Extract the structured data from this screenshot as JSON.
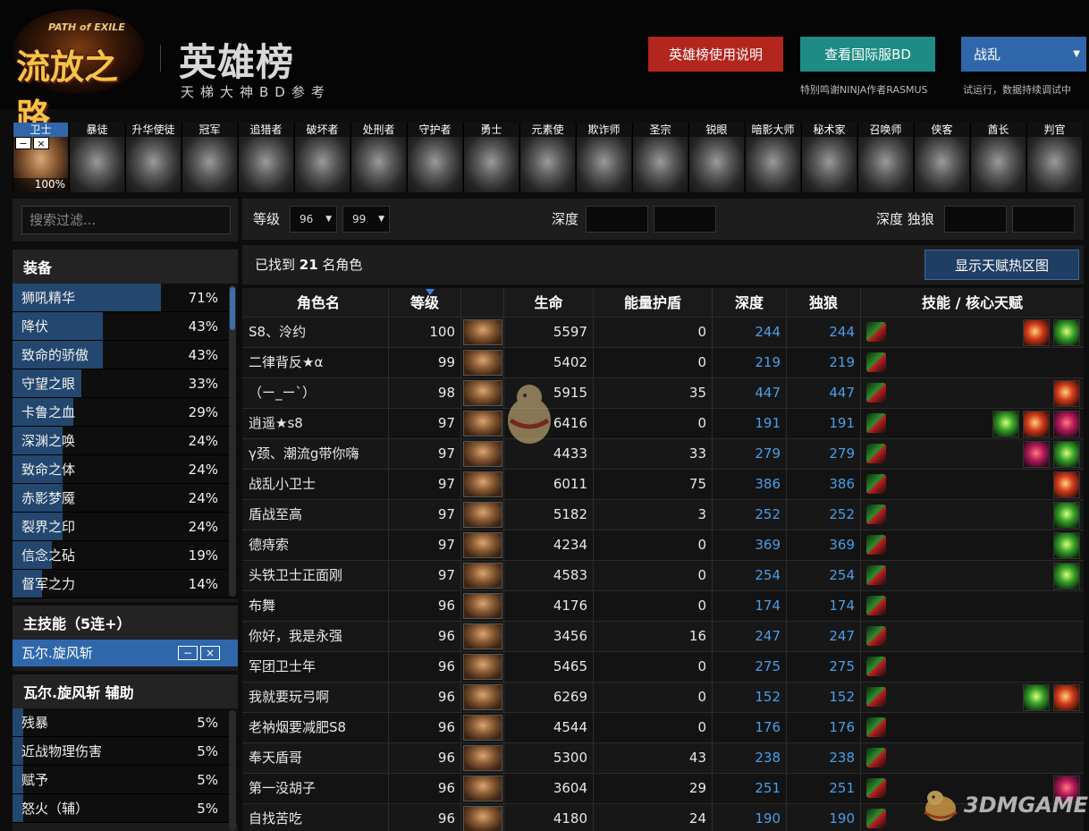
{
  "header": {
    "logo_small": "PATH of EXILE",
    "logo_main": "流放之路",
    "title": "英雄榜",
    "subtitle": "天梯大神BD参考",
    "btn_guide": "英雄榜使用说明",
    "btn_intl": "查看国际服BD",
    "league": "战乱",
    "note_thanks": "特别鸣谢NINJA作者RASMUS",
    "note_trial": "试运行，数据持续调试中"
  },
  "classes": [
    "卫士",
    "暴徒",
    "升华使徒",
    "冠军",
    "追猎者",
    "破坏者",
    "处刑者",
    "守护者",
    "勇士",
    "元素使",
    "欺诈师",
    "圣宗",
    "锐眼",
    "暗影大师",
    "秘术家",
    "召唤师",
    "侠客",
    "酋长",
    "判官"
  ],
  "selected_class_pct": "100%",
  "class_ctrl_minus": "−",
  "class_ctrl_close": "×",
  "search": {
    "placeholder": "搜索过滤..."
  },
  "gear": {
    "title": "装备",
    "items": [
      {
        "label": "狮吼精华",
        "value": "71%",
        "frac": 0.71
      },
      {
        "label": "降伏",
        "value": "43%",
        "frac": 0.43
      },
      {
        "label": "致命的骄傲",
        "value": "43%",
        "frac": 0.43
      },
      {
        "label": "守望之眼",
        "value": "33%",
        "frac": 0.33
      },
      {
        "label": "卡鲁之血",
        "value": "29%",
        "frac": 0.29
      },
      {
        "label": "深渊之唤",
        "value": "24%",
        "frac": 0.24
      },
      {
        "label": "致命之体",
        "value": "24%",
        "frac": 0.24
      },
      {
        "label": "赤影梦魇",
        "value": "24%",
        "frac": 0.24
      },
      {
        "label": "裂界之印",
        "value": "24%",
        "frac": 0.24
      },
      {
        "label": "信念之砧",
        "value": "19%",
        "frac": 0.19
      },
      {
        "label": "督军之力",
        "value": "14%",
        "frac": 0.14
      }
    ]
  },
  "main_skill": {
    "title": "主技能（5连+）",
    "selected": "瓦尔.旋风斩",
    "ctrl_minus": "−",
    "ctrl_close": "×"
  },
  "support": {
    "title": "瓦尔.旋风斩 辅助",
    "items": [
      {
        "label": "残暴",
        "value": "5%",
        "frac": 0.05
      },
      {
        "label": "近战物理伤害",
        "value": "5%",
        "frac": 0.05
      },
      {
        "label": "赋予",
        "value": "5%",
        "frac": 0.05
      },
      {
        "label": "怒火（辅）",
        "value": "5%",
        "frac": 0.05
      }
    ]
  },
  "filters": {
    "level_label": "等级",
    "level_min": "96",
    "level_max": "99",
    "depth_label": "深度",
    "depth_solo_label": "深度 独狼"
  },
  "result": {
    "prefix": "已找到 ",
    "count": "21",
    "suffix": " 名角色",
    "heatmap_btn": "显示天赋热区图"
  },
  "table": {
    "headers": {
      "name": "角色名",
      "level": "等级",
      "life": "生命",
      "es": "能量护盾",
      "depth": "深度",
      "solo": "独狼",
      "skills": "技能 / 核心天赋"
    },
    "rows": [
      {
        "name": "S8、泠约",
        "level": "100",
        "life": "5597",
        "es": "0",
        "depth": "244",
        "solo": "244",
        "side": [
          "red",
          "green"
        ]
      },
      {
        "name": "二律背反★α",
        "level": "99",
        "life": "5402",
        "es": "0",
        "depth": "219",
        "solo": "219",
        "side": []
      },
      {
        "name": "（ー_ー`）",
        "level": "98",
        "life": "5915",
        "es": "35",
        "depth": "447",
        "solo": "447",
        "side": [
          "red"
        ]
      },
      {
        "name": "逍遥★s8",
        "level": "97",
        "life": "6416",
        "es": "0",
        "depth": "191",
        "solo": "191",
        "side": [
          "green",
          "red",
          "purple"
        ]
      },
      {
        "name": "γ颈、潮流g带你嗨",
        "level": "97",
        "life": "4433",
        "es": "33",
        "depth": "279",
        "solo": "279",
        "side": [
          "purple",
          "green"
        ]
      },
      {
        "name": "战乱小卫士",
        "level": "97",
        "life": "6011",
        "es": "75",
        "depth": "386",
        "solo": "386",
        "side": [
          "red"
        ]
      },
      {
        "name": "盾战至高",
        "level": "97",
        "life": "5182",
        "es": "3",
        "depth": "252",
        "solo": "252",
        "side": [
          "green"
        ]
      },
      {
        "name": "德痔索",
        "level": "97",
        "life": "4234",
        "es": "0",
        "depth": "369",
        "solo": "369",
        "side": [
          "green"
        ]
      },
      {
        "name": "头铁卫士正面刚",
        "level": "97",
        "life": "4583",
        "es": "0",
        "depth": "254",
        "solo": "254",
        "side": [
          "green"
        ]
      },
      {
        "name": "布舞",
        "level": "96",
        "life": "4176",
        "es": "0",
        "depth": "174",
        "solo": "174",
        "side": []
      },
      {
        "name": "你好，我是永强",
        "level": "96",
        "life": "3456",
        "es": "16",
        "depth": "247",
        "solo": "247",
        "side": []
      },
      {
        "name": "军团卫士年",
        "level": "96",
        "life": "5465",
        "es": "0",
        "depth": "275",
        "solo": "275",
        "side": []
      },
      {
        "name": "我就要玩弓啊",
        "level": "96",
        "life": "6269",
        "es": "0",
        "depth": "152",
        "solo": "152",
        "side": [
          "green",
          "red"
        ]
      },
      {
        "name": "老衲烟要减肥S8",
        "level": "96",
        "life": "4544",
        "es": "0",
        "depth": "176",
        "solo": "176",
        "side": []
      },
      {
        "name": "奉天盾哥",
        "level": "96",
        "life": "5300",
        "es": "43",
        "depth": "238",
        "solo": "238",
        "side": []
      },
      {
        "name": "第一没胡子",
        "level": "96",
        "life": "3604",
        "es": "29",
        "depth": "251",
        "solo": "251",
        "side": [
          "purple"
        ]
      },
      {
        "name": "自找苦吃",
        "level": "96",
        "life": "4180",
        "es": "24",
        "depth": "190",
        "solo": "190",
        "side": []
      }
    ]
  },
  "watermark": "3DMGAME",
  "colors": {
    "accent_blue": "#2f67aa",
    "btn_red": "#b3261e",
    "btn_teal": "#1e8c84",
    "depth_blue": "#4a9ee8"
  }
}
